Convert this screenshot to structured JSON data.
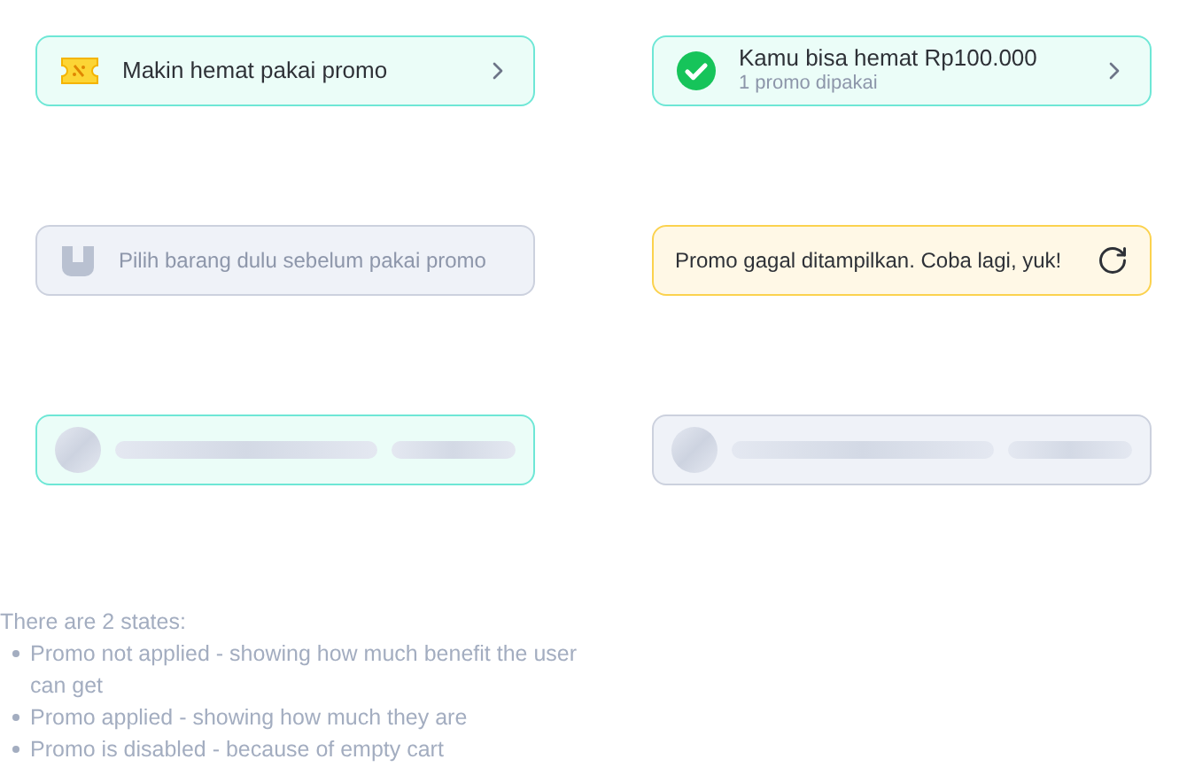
{
  "cards": [
    {
      "kind": "promo",
      "title": "Makin hemat pakai promo"
    },
    {
      "kind": "applied",
      "title": "Kamu bisa hemat Rp100.000",
      "subtitle": "1 promo dipakai"
    },
    {
      "kind": "disabled",
      "title": "Pilih barang dulu sebelum pakai promo"
    },
    {
      "kind": "error",
      "title": "Promo gagal ditampilkan. Coba lagi, yuk!"
    },
    {
      "kind": "loading"
    },
    {
      "kind": "loading-disabled"
    }
  ],
  "notes": {
    "intro": "There are 2 states:",
    "bullets": [
      "Promo not applied - showing how much benefit the user can get",
      "Promo applied  - showing how much they are",
      "Promo is disabled - because of empty cart"
    ]
  }
}
